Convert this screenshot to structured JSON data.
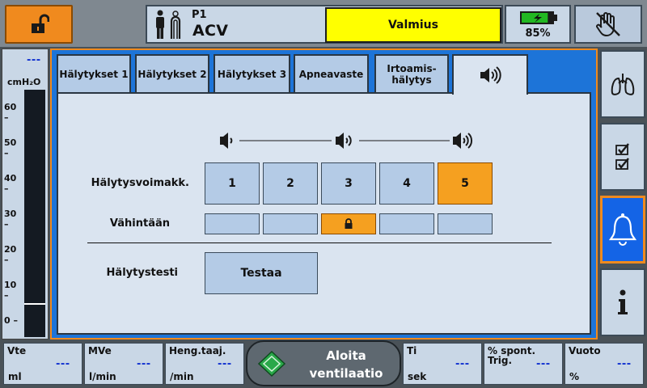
{
  "header": {
    "patient_id": "P1",
    "mode": "ACV",
    "status": "Valmius",
    "battery_percent": "85%",
    "battery_level": 0.85,
    "icons": {
      "lock": "unlocked-padlock-icon",
      "person": "adult-patient-icon",
      "hand": "alarm-silence-hand-icon"
    }
  },
  "pressure": {
    "value": "---",
    "unit": "cmH₂O",
    "ticks": [
      "60",
      "50",
      "40",
      "30",
      "20",
      "10",
      "0"
    ],
    "marker_value": 5
  },
  "tabs": [
    {
      "label": "Hälytykset 1"
    },
    {
      "label": "Hälytykset 2"
    },
    {
      "label": "Hälytykset 3"
    },
    {
      "label": "Apneavaste"
    },
    {
      "label": "Irtoamis-\nhälytys"
    },
    {
      "label": "",
      "icon": "speaker-volume-icon"
    }
  ],
  "alarm_volume": {
    "label": "Hälytysvoimakk.",
    "options": [
      "1",
      "2",
      "3",
      "4",
      "5"
    ],
    "selected": "5"
  },
  "minimum": {
    "label": "Vähintään",
    "locked_level": "3"
  },
  "alarm_test": {
    "label": "Hälytystesti",
    "button": "Testaa"
  },
  "sidebar": [
    {
      "icon": "lungs-icon"
    },
    {
      "icon": "checklist-icon"
    },
    {
      "icon": "alarm-bell-icon",
      "active": true
    },
    {
      "icon": "info-icon"
    }
  ],
  "readouts": [
    {
      "label": "Vte",
      "unit": "ml",
      "value": "---"
    },
    {
      "label": "MVe",
      "unit": "l/min",
      "value": "---"
    },
    {
      "label": "Heng.taaj.",
      "unit": "/min",
      "value": "---"
    },
    {
      "label": "Ti",
      "unit": "sek",
      "value": "---"
    },
    {
      "label": "% spont.\nTrig.",
      "unit": "",
      "value": "---"
    },
    {
      "label": "Vuoto",
      "unit": "%",
      "value": "---"
    }
  ],
  "start_button": {
    "label": "Aloita\nventilaatio"
  },
  "colors": {
    "accent_orange": "#f08a1e",
    "selected_blue": "#1464e6",
    "status_yellow": "#ffff00",
    "value_blue": "#1030d0"
  }
}
